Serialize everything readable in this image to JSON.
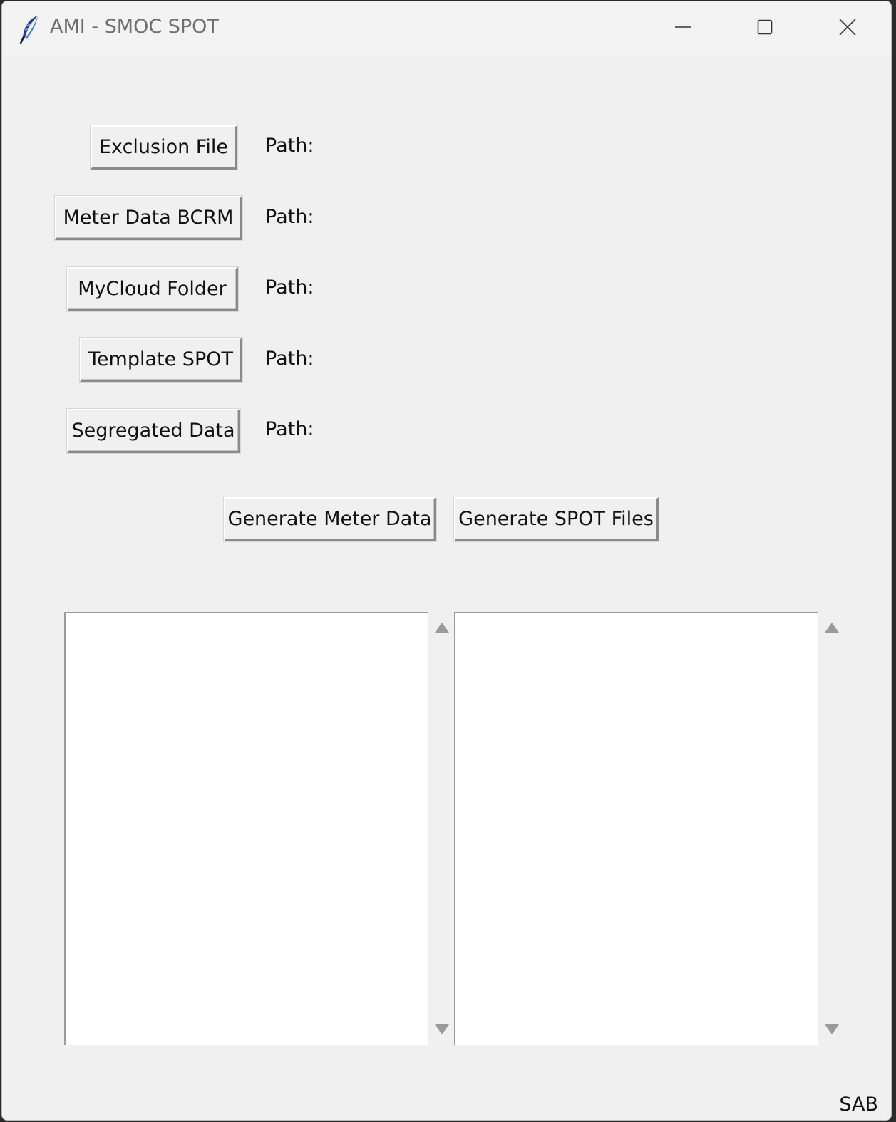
{
  "window": {
    "title": "AMI - SMOC SPOT",
    "icons": {
      "app": "feather-icon",
      "minimize": "minimize-icon",
      "maximize": "maximize-icon",
      "close": "close-icon"
    }
  },
  "file_rows": [
    {
      "button_label": "Exclusion File",
      "path_label": "Path:"
    },
    {
      "button_label": "Meter Data BCRM",
      "path_label": "Path:"
    },
    {
      "button_label": "MyCloud Folder",
      "path_label": "Path:"
    },
    {
      "button_label": "Template SPOT",
      "path_label": "Path:"
    },
    {
      "button_label": "Segregated Data",
      "path_label": "Path:"
    }
  ],
  "actions": {
    "generate_meter_data": "Generate Meter Data",
    "generate_spot_files": "Generate SPOT Files"
  },
  "footer": {
    "text": "SAB"
  }
}
